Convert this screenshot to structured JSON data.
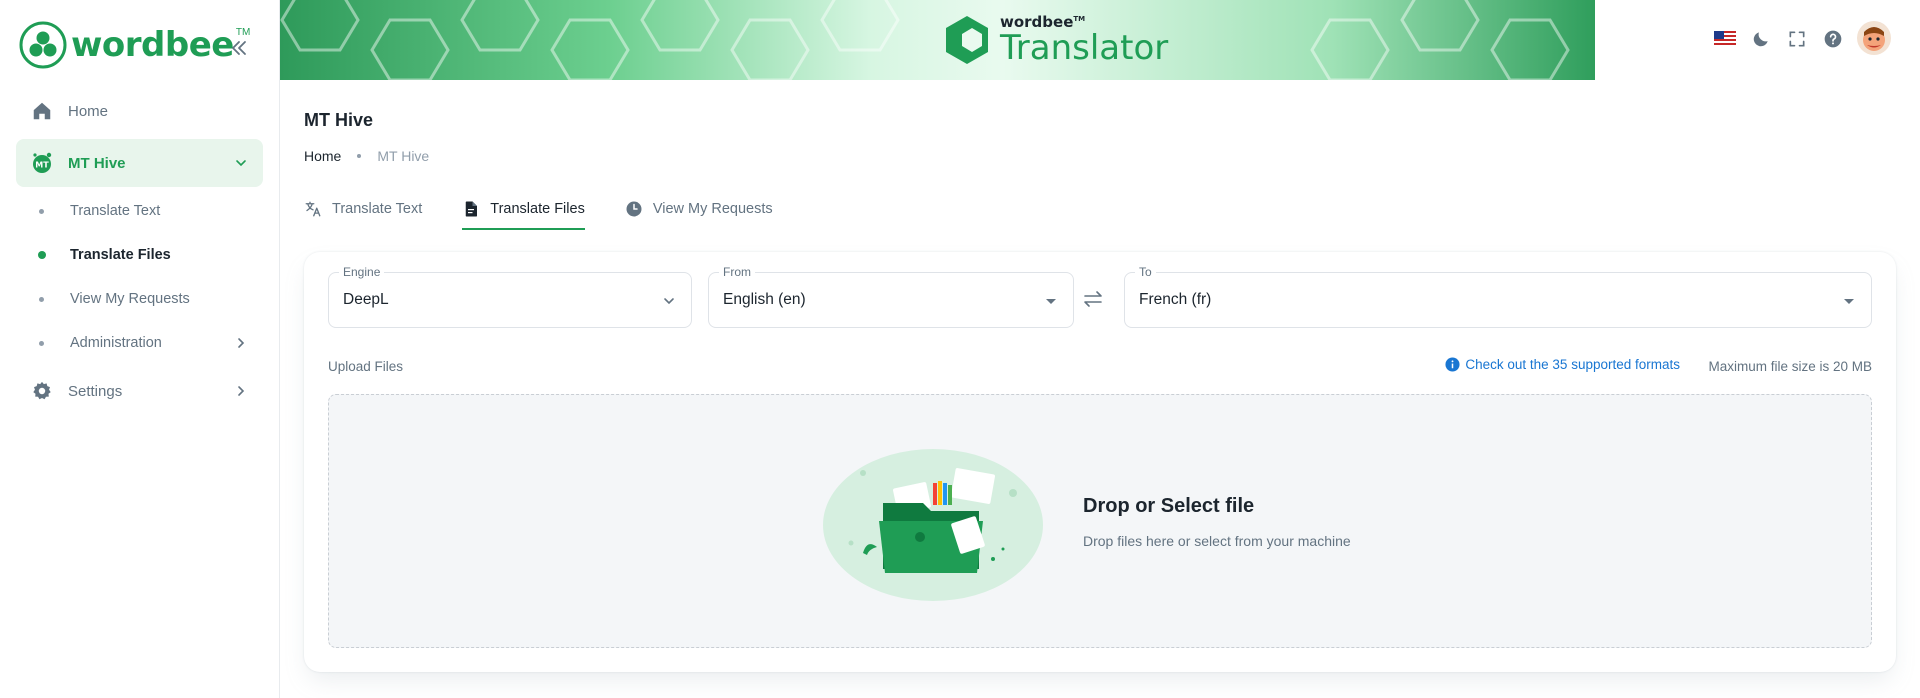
{
  "brand": {
    "logo_text": "wordbee",
    "logo_tm": "TM",
    "banner_small": "wordbee",
    "banner_tm": "TM",
    "banner_big": "Translator"
  },
  "sidebar": {
    "items": [
      {
        "label": "Home",
        "icon": "home-icon"
      },
      {
        "label": "MT Hive",
        "icon": "mt-hive-icon",
        "icon_text": "MT",
        "expanded": true
      },
      {
        "label": "Settings",
        "icon": "gear-icon"
      }
    ],
    "sub_items": [
      {
        "label": "Translate Text"
      },
      {
        "label": "Translate Files",
        "active": true
      },
      {
        "label": "View My Requests"
      },
      {
        "label": "Administration"
      }
    ]
  },
  "header": {
    "icons": [
      "us-flag-icon",
      "moon-icon",
      "fullscreen-icon",
      "help-icon",
      "avatar"
    ]
  },
  "page": {
    "title": "MT Hive",
    "breadcrumb": [
      "Home",
      "MT Hive"
    ]
  },
  "tabs": [
    {
      "label": "Translate Text",
      "icon": "translate-icon"
    },
    {
      "label": "Translate Files",
      "icon": "file-icon",
      "active": true
    },
    {
      "label": "View My Requests",
      "icon": "clock-icon"
    }
  ],
  "form": {
    "engine": {
      "label": "Engine",
      "value": "DeepL"
    },
    "from": {
      "label": "From",
      "value": "English (en)"
    },
    "to": {
      "label": "To",
      "value": "French (fr)"
    }
  },
  "upload": {
    "label": "Upload Files",
    "formats_link": "Check out the 35 supported formats",
    "max_size": "Maximum file size is 20 MB",
    "drop_title": "Drop or Select file",
    "drop_subtitle": "Drop files here or select from your machine"
  },
  "colors": {
    "accent": "#1f9d55",
    "link": "#1976d2",
    "text": "#1c252e",
    "muted": "#637381"
  }
}
